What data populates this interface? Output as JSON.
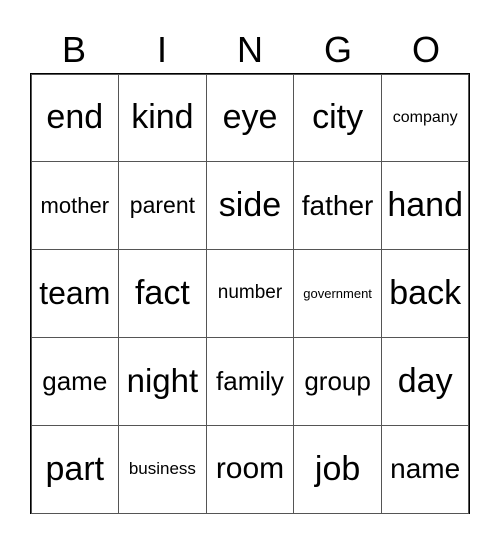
{
  "header": [
    "B",
    "I",
    "N",
    "G",
    "O"
  ],
  "cells": [
    [
      "end",
      "kind",
      "eye",
      "city",
      "company"
    ],
    [
      "mother",
      "parent",
      "side",
      "father",
      "hand"
    ],
    [
      "team",
      "fact",
      "number",
      "government",
      "back"
    ],
    [
      "game",
      "night",
      "family",
      "group",
      "day"
    ],
    [
      "part",
      "business",
      "room",
      "job",
      "name"
    ]
  ]
}
